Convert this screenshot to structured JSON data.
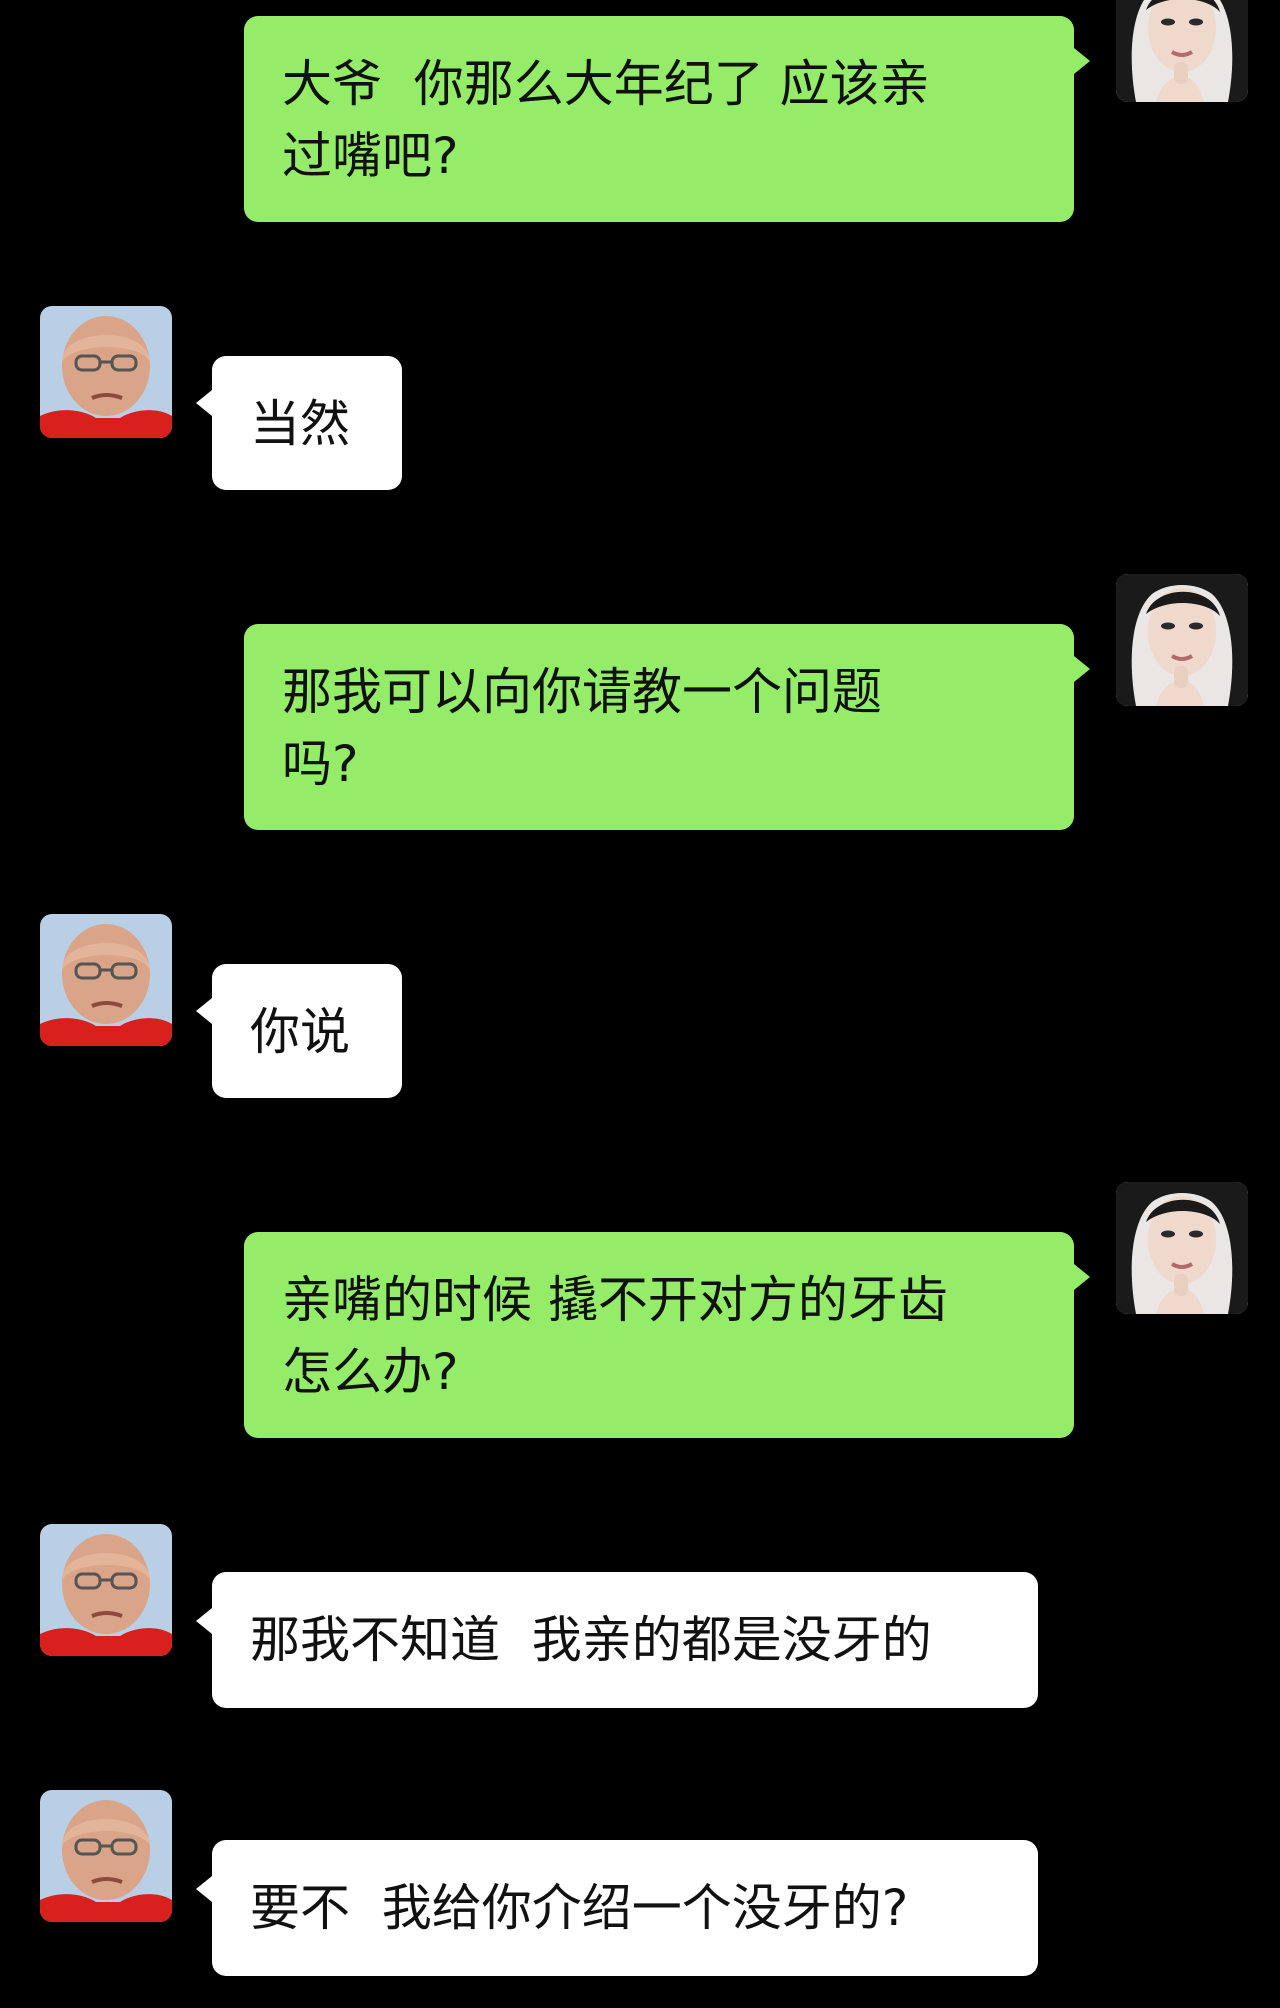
{
  "colors": {
    "background": "#000000",
    "outgoing_bubble": "#95ec69",
    "incoming_bubble": "#ffffff",
    "text": "#111111"
  },
  "messages": [
    {
      "sender": "me",
      "avatar": "young-woman-avatar",
      "text": "大爷  你那么大年纪了 应该亲\n过嘴吧?"
    },
    {
      "sender": "other",
      "avatar": "old-man-avatar",
      "text": "当然"
    },
    {
      "sender": "me",
      "avatar": "young-woman-avatar",
      "text": "那我可以向你请教一个问题\n吗?"
    },
    {
      "sender": "other",
      "avatar": "old-man-avatar",
      "text": "你说"
    },
    {
      "sender": "me",
      "avatar": "young-woman-avatar",
      "text": "亲嘴的时候 撬不开对方的牙齿\n怎么办?"
    },
    {
      "sender": "other",
      "avatar": "old-man-avatar",
      "text": "那我不知道  我亲的都是没牙的"
    },
    {
      "sender": "other",
      "avatar": "old-man-avatar",
      "text": "要不  我给你介绍一个没牙的?"
    }
  ]
}
